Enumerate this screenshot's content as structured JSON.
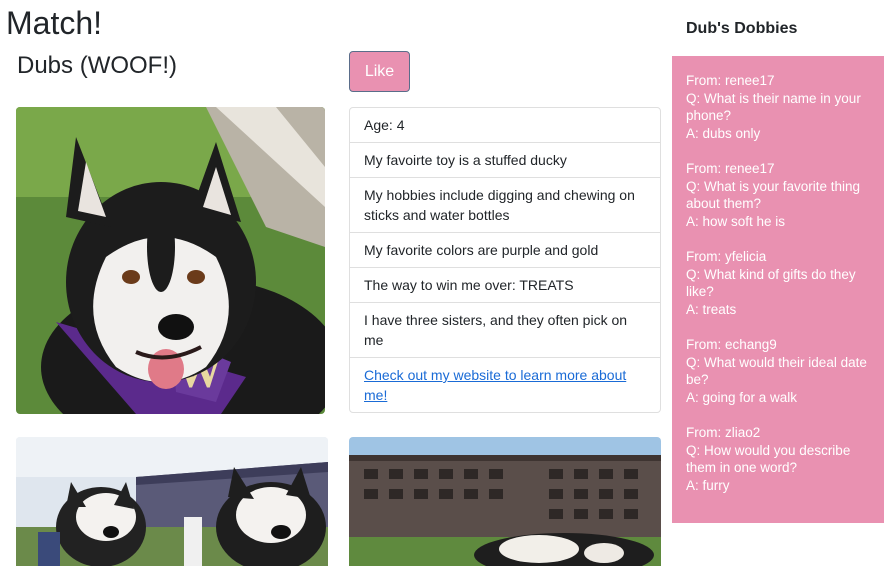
{
  "page": {
    "title": "Match!"
  },
  "profile": {
    "name": "Dubs (WOOF!)",
    "like_label": "Like",
    "details": [
      "Age: 4",
      "My favoirte toy is a stuffed ducky",
      "My hobbies include digging and chewing on sticks and water bottles",
      "My favorite colors are purple and gold",
      "The way to win me over: TREATS",
      "I have three sisters, and they often pick on me"
    ],
    "website_link": "Check out my website to learn more about me!"
  },
  "photos": [
    {
      "icon": "husky-portrait-photo"
    },
    {
      "icon": "husky-stadium-photo"
    },
    {
      "icon": "husky-campus-photo"
    }
  ],
  "sidebar": {
    "title": "Dub's Dobbies",
    "entries": [
      {
        "from": "From: renee17",
        "question": "Q: What is their name in your phone?",
        "answer": "A: dubs only"
      },
      {
        "from": "From: renee17",
        "question": "Q: What is your favorite thing about them?",
        "answer": "A: how soft he is"
      },
      {
        "from": "From: yfelicia",
        "question": "Q: What kind of gifts do they like?",
        "answer": "A: treats"
      },
      {
        "from": "From: echang9",
        "question": "Q: What would their ideal date be?",
        "answer": "A: going for a walk"
      },
      {
        "from": "From: zliao2",
        "question": "Q: How would you describe them in one word?",
        "answer": "A: furry"
      }
    ]
  },
  "colors": {
    "accent": "#e991b1",
    "link": "#1a6bd6",
    "text": "#212529"
  }
}
